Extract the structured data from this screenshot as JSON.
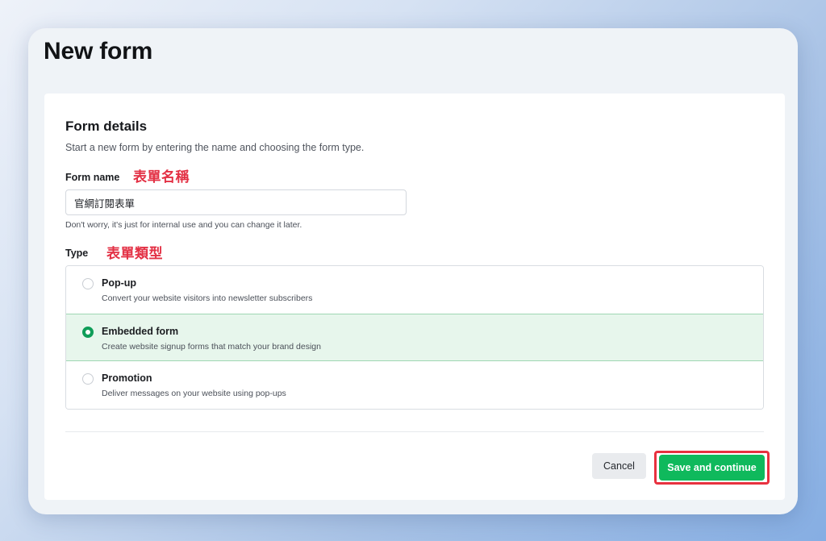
{
  "page": {
    "title": "New form"
  },
  "form_details": {
    "title": "Form details",
    "subtitle": "Start a new form by entering the name and choosing the form type."
  },
  "form_name": {
    "label": "Form name",
    "annotation": "表單名稱",
    "value": "官網訂閱表單",
    "helper": "Don't worry, it's just for internal use and you can change it later."
  },
  "type": {
    "label": "Type",
    "annotation": "表單類型",
    "options": [
      {
        "title": "Pop-up",
        "description": "Convert your website visitors into newsletter subscribers",
        "selected": false
      },
      {
        "title": "Embedded form",
        "description": "Create website signup forms that match your brand design",
        "selected": true
      },
      {
        "title": "Promotion",
        "description": "Deliver messages on your website using pop-ups",
        "selected": false
      }
    ]
  },
  "actions": {
    "cancel_label": "Cancel",
    "save_label": "Save and continue"
  },
  "colors": {
    "accent_green": "#0fb95c",
    "selected_bg": "#e7f6ec",
    "annotation_red": "#e33044"
  }
}
